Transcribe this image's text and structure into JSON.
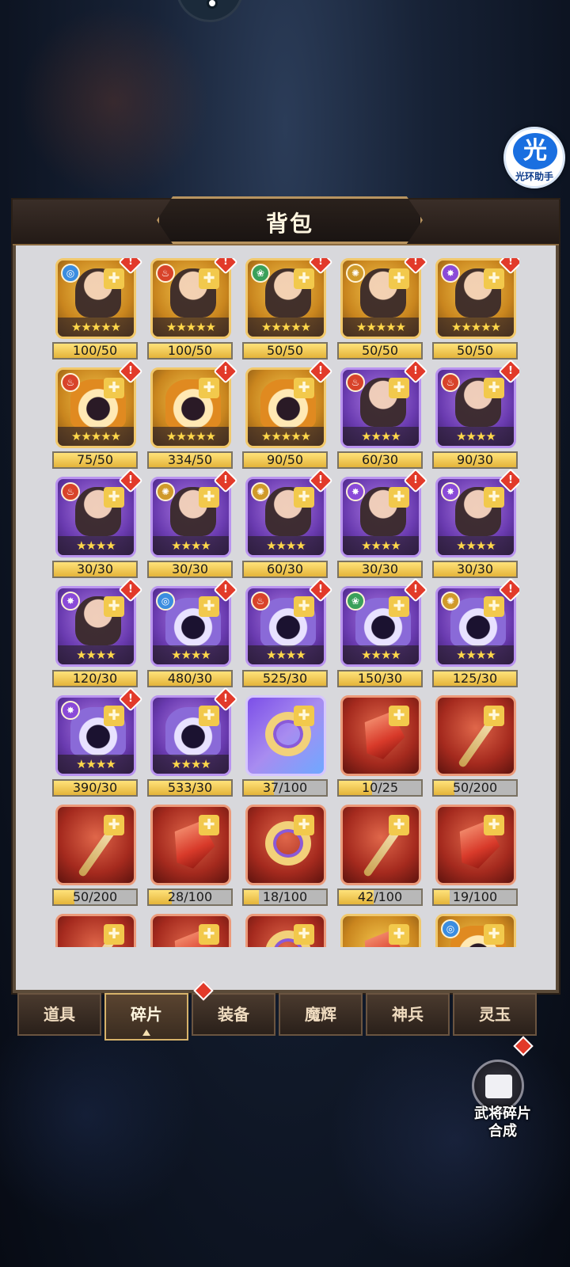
{
  "header": {
    "title": "背包"
  },
  "assistant": {
    "glyph": "光",
    "label": "光环助手"
  },
  "items": [
    {
      "frame": "gold",
      "kind": "hero",
      "elem": "water",
      "stars": "★★★★★",
      "count": "100/50",
      "progress": 1.0
    },
    {
      "frame": "gold",
      "kind": "hero",
      "elem": "fire",
      "stars": "★★★★★",
      "count": "100/50",
      "progress": 1.0
    },
    {
      "frame": "gold",
      "kind": "hero",
      "elem": "wind",
      "stars": "★★★★★",
      "count": "50/50",
      "progress": 1.0
    },
    {
      "frame": "gold",
      "kind": "hero",
      "elem": "light",
      "stars": "★★★★★",
      "count": "50/50",
      "progress": 1.0
    },
    {
      "frame": "gold",
      "kind": "hero",
      "elem": "dark",
      "stars": "★★★★★",
      "count": "50/50",
      "progress": 1.0
    },
    {
      "frame": "gold",
      "kind": "helmet",
      "elem": "fire",
      "stars": "★★★★★",
      "count": "75/50",
      "progress": 1.0
    },
    {
      "frame": "gold",
      "kind": "helmet",
      "elem": "",
      "stars": "★★★★★",
      "count": "334/50",
      "progress": 1.0
    },
    {
      "frame": "gold",
      "kind": "helmet",
      "elem": "",
      "stars": "★★★★★",
      "count": "90/50",
      "progress": 1.0
    },
    {
      "frame": "purple",
      "kind": "hero",
      "elem": "fire",
      "stars": "★★★★",
      "count": "60/30",
      "progress": 1.0
    },
    {
      "frame": "purple",
      "kind": "hero",
      "elem": "fire",
      "stars": "★★★★",
      "count": "90/30",
      "progress": 1.0
    },
    {
      "frame": "purple",
      "kind": "hero",
      "elem": "fire",
      "stars": "★★★★",
      "count": "30/30",
      "progress": 1.0
    },
    {
      "frame": "purple",
      "kind": "hero",
      "elem": "light",
      "stars": "★★★★",
      "count": "30/30",
      "progress": 1.0
    },
    {
      "frame": "purple",
      "kind": "hero",
      "elem": "light",
      "stars": "★★★★",
      "count": "60/30",
      "progress": 1.0
    },
    {
      "frame": "purple",
      "kind": "hero",
      "elem": "dark",
      "stars": "★★★★",
      "count": "30/30",
      "progress": 1.0
    },
    {
      "frame": "purple",
      "kind": "hero",
      "elem": "dark",
      "stars": "★★★★",
      "count": "30/30",
      "progress": 1.0
    },
    {
      "frame": "purple",
      "kind": "hero",
      "elem": "dark",
      "stars": "★★★★",
      "count": "120/30",
      "progress": 1.0
    },
    {
      "frame": "purple",
      "kind": "helmet",
      "elem": "water",
      "stars": "★★★★",
      "count": "480/30",
      "progress": 1.0
    },
    {
      "frame": "purple",
      "kind": "helmet",
      "elem": "fire",
      "stars": "★★★★",
      "count": "525/30",
      "progress": 1.0
    },
    {
      "frame": "purple",
      "kind": "helmet",
      "elem": "wind",
      "stars": "★★★★",
      "count": "150/30",
      "progress": 1.0
    },
    {
      "frame": "purple",
      "kind": "helmet",
      "elem": "light",
      "stars": "★★★★",
      "count": "125/30",
      "progress": 1.0
    },
    {
      "frame": "purple",
      "kind": "helmet",
      "elem": "dark",
      "stars": "★★★★",
      "count": "390/30",
      "progress": 1.0
    },
    {
      "frame": "purple",
      "kind": "helmet",
      "elem": "",
      "stars": "★★★★",
      "count": "533/30",
      "progress": 1.0
    },
    {
      "frame": "special",
      "kind": "ring",
      "elem": "",
      "stars": "",
      "count": "37/100",
      "progress": 0.37
    },
    {
      "frame": "red",
      "kind": "gem",
      "elem": "",
      "stars": "",
      "count": "10/25",
      "progress": 0.4
    },
    {
      "frame": "red",
      "kind": "staff",
      "elem": "",
      "stars": "",
      "count": "50/200",
      "progress": 0.25
    },
    {
      "frame": "red",
      "kind": "staff",
      "elem": "",
      "stars": "",
      "count": "50/200",
      "progress": 0.25
    },
    {
      "frame": "red",
      "kind": "gem",
      "elem": "",
      "stars": "",
      "count": "28/100",
      "progress": 0.28
    },
    {
      "frame": "red",
      "kind": "ring",
      "elem": "",
      "stars": "",
      "count": "18/100",
      "progress": 0.18
    },
    {
      "frame": "red",
      "kind": "staff",
      "elem": "",
      "stars": "",
      "count": "42/100",
      "progress": 0.42
    },
    {
      "frame": "red",
      "kind": "gem",
      "elem": "",
      "stars": "",
      "count": "19/100",
      "progress": 0.19
    },
    {
      "frame": "red",
      "kind": "staff",
      "elem": "",
      "stars": "",
      "count": "",
      "progress": 0
    },
    {
      "frame": "red",
      "kind": "gem",
      "elem": "",
      "stars": "",
      "count": "",
      "progress": 0
    },
    {
      "frame": "red",
      "kind": "ring",
      "elem": "",
      "stars": "",
      "count": "",
      "progress": 0
    },
    {
      "frame": "gold",
      "kind": "gem",
      "elem": "",
      "stars": "",
      "count": "",
      "progress": 0
    },
    {
      "frame": "gold",
      "kind": "helmet",
      "elem": "water",
      "stars": "",
      "count": "",
      "progress": 0
    }
  ],
  "tabs": [
    {
      "label": "道具",
      "active": false
    },
    {
      "label": "碎片",
      "active": true
    },
    {
      "label": "装备",
      "active": false
    },
    {
      "label": "魔辉",
      "active": false
    },
    {
      "label": "神兵",
      "active": false
    },
    {
      "label": "灵玉",
      "active": false
    }
  ],
  "synthesis": {
    "label_line1": "武将碎片",
    "label_line2": "合成"
  },
  "colors": {
    "gold_frame": "#f1c86b",
    "purple_frame": "#b993ef",
    "red_frame": "#ec9a7a",
    "progress_fill": "#e4b43a",
    "alert": "#e23a2a",
    "panel_bg": "#d8d8dc"
  },
  "icons": {
    "alert": "!",
    "puzzle": "✚",
    "element_glyphs": {
      "water": "◎",
      "fire": "♨",
      "wind": "❀",
      "light": "✺",
      "dark": "✸"
    },
    "element_colors": {
      "water": "#3b8de0",
      "fire": "#d8432a",
      "wind": "#3aa05a",
      "light": "#d09a2a",
      "dark": "#8a4ad8"
    }
  }
}
